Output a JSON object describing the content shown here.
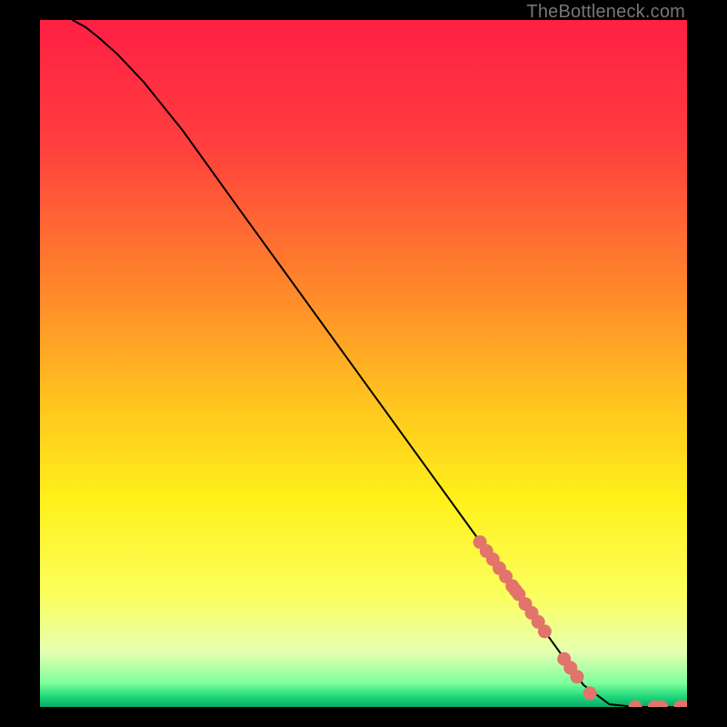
{
  "attribution": "TheBottleneck.com",
  "chart_data": {
    "type": "line",
    "title": "",
    "xlabel": "",
    "ylabel": "",
    "xlim": [
      0,
      100
    ],
    "ylim": [
      0,
      100
    ],
    "gradient_stops": [
      {
        "offset": 0.0,
        "color": "#ff1f44"
      },
      {
        "offset": 0.18,
        "color": "#ff3e3e"
      },
      {
        "offset": 0.4,
        "color": "#ff8a2a"
      },
      {
        "offset": 0.55,
        "color": "#ffc21f"
      },
      {
        "offset": 0.7,
        "color": "#fff11a"
      },
      {
        "offset": 0.84,
        "color": "#fbff60"
      },
      {
        "offset": 0.92,
        "color": "#e6ffb0"
      },
      {
        "offset": 0.965,
        "color": "#7fff9c"
      },
      {
        "offset": 0.985,
        "color": "#1fd87a"
      },
      {
        "offset": 1.0,
        "color": "#0aa868"
      }
    ],
    "series": [
      {
        "name": "curve",
        "type": "line",
        "x": [
          5,
          7,
          9,
          12,
          16,
          22,
          30,
          40,
          50,
          60,
          70,
          78,
          84,
          88,
          92,
          96,
          100
        ],
        "y": [
          100,
          99,
          97.5,
          95,
          91,
          84,
          73.5,
          60.5,
          47.5,
          34.5,
          21.5,
          11,
          3.2,
          0.4,
          0,
          0,
          0
        ]
      },
      {
        "name": "markers",
        "type": "scatter",
        "x": [
          68,
          69,
          70,
          71,
          72,
          73,
          73.5,
          74,
          75,
          76,
          77,
          78,
          81,
          82,
          83,
          85,
          92,
          95,
          96,
          99,
          100
        ],
        "y": [
          24,
          22.7,
          21.5,
          20.2,
          19,
          17.6,
          17,
          16.4,
          15,
          13.7,
          12.4,
          11,
          7,
          5.7,
          4.4,
          2.0,
          0,
          0,
          0,
          0,
          0
        ]
      }
    ],
    "marker_color": "#e2746b",
    "line_color": "#000000"
  }
}
